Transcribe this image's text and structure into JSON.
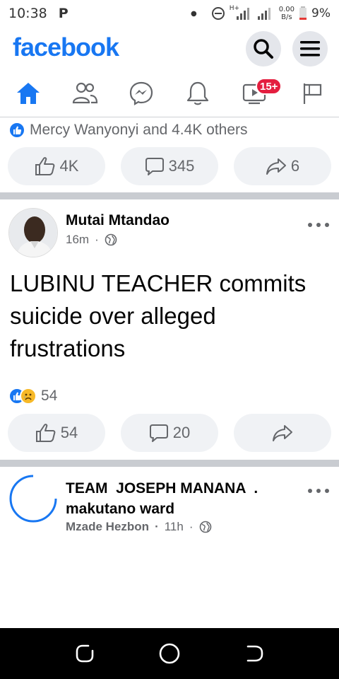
{
  "status_bar": {
    "time": "10:38",
    "app_indicator": "P",
    "network_type": "H+",
    "net_speed_value": "0.00",
    "net_speed_unit": "B/s",
    "battery": "9%"
  },
  "header": {
    "logo": "facebook",
    "search_icon": "search-icon",
    "menu_icon": "menu-icon"
  },
  "nav": {
    "items": [
      {
        "name": "home",
        "icon": "home-icon",
        "active": true
      },
      {
        "name": "friends",
        "icon": "friends-icon"
      },
      {
        "name": "messenger",
        "icon": "messenger-icon"
      },
      {
        "name": "notifications",
        "icon": "bell-icon"
      },
      {
        "name": "watch",
        "icon": "video-icon",
        "badge": "15+"
      },
      {
        "name": "pages",
        "icon": "flag-icon"
      }
    ],
    "accent": "#1877f2",
    "badge_color": "#e41e3f"
  },
  "post_prev": {
    "reactions_text": "Mercy Wanyonyi and 4.4K others",
    "like_count": "4K",
    "comment_count": "345",
    "share_count": "6"
  },
  "post_1": {
    "author": "Mutai Mtandao",
    "time": "16m",
    "text": "LUBINU TEACHER  commits suicide over alleged frustrations",
    "reaction_count": "54",
    "like_count": "54",
    "comment_count": "20"
  },
  "post_2": {
    "title": "TEAM  JOSEPH MANANA  .\nmakutano ward",
    "author": "Mzade Hezbon",
    "time": "11h"
  }
}
